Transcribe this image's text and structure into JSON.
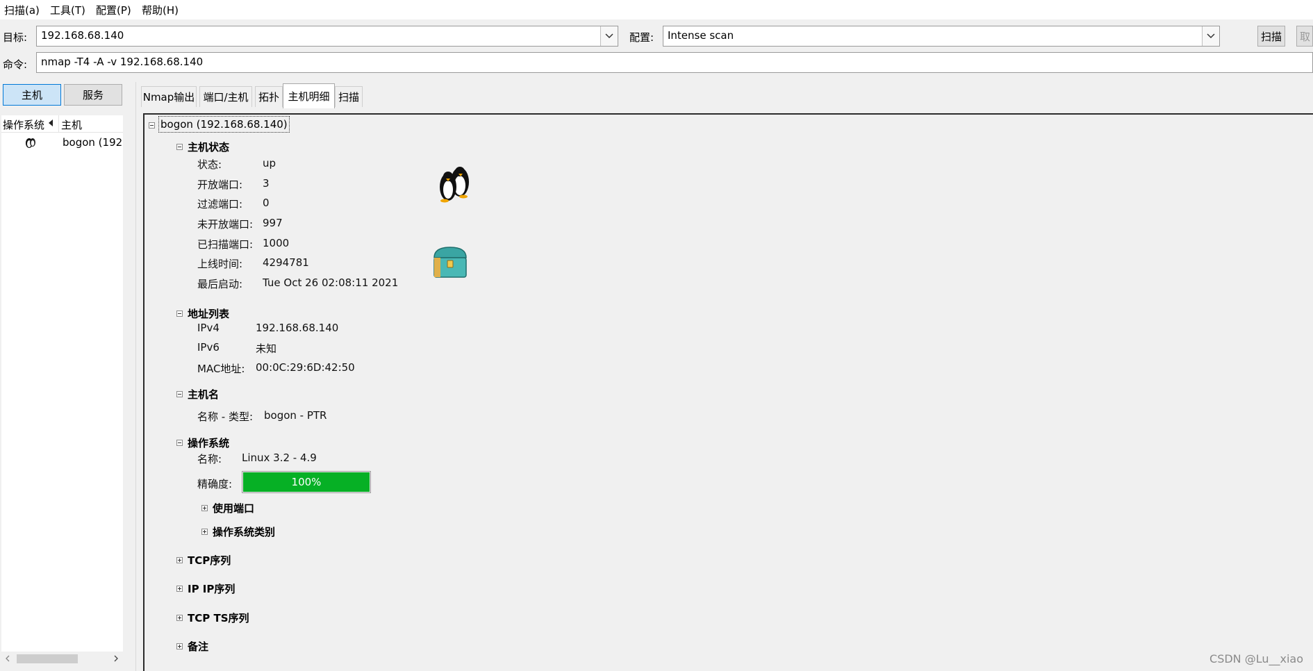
{
  "menubar": {
    "items": [
      "扫描(a)",
      "工具(T)",
      "配置(P)",
      "帮助(H)"
    ]
  },
  "toolbar": {
    "target_label": "目标:",
    "target_value": "192.168.68.140",
    "profile_label": "配置:",
    "profile_value": "Intense scan",
    "scan_button": "扫描",
    "cancel_button": "取",
    "command_label": "命令:",
    "command_value": "nmap -T4 -A -v 192.168.68.140"
  },
  "left_panel": {
    "hosts_button": "主机",
    "services_button": "服务",
    "col_os": "操作系统",
    "col_host": "主机",
    "rows": [
      {
        "host": "bogon (192"
      }
    ]
  },
  "tabs": [
    "Nmap输出",
    "端口/主机",
    "拓扑",
    "主机明细",
    "扫描"
  ],
  "active_tab": "主机明细",
  "details": {
    "root": "bogon (192.168.68.140)",
    "host_status": {
      "title": "主机状态",
      "rows": [
        {
          "k": "状态:",
          "v": "up"
        },
        {
          "k": "开放端口:",
          "v": "3"
        },
        {
          "k": "过滤端口:",
          "v": "0"
        },
        {
          "k": "未开放端口:",
          "v": "997"
        },
        {
          "k": "已扫描端口:",
          "v": "1000"
        },
        {
          "k": "上线时间:",
          "v": "4294781"
        },
        {
          "k": "最后启动:",
          "v": "Tue Oct 26 02:08:11 2021"
        }
      ]
    },
    "addresses": {
      "title": "地址列表",
      "rows": [
        {
          "k": "IPv4",
          "v": "192.168.68.140"
        },
        {
          "k": "IPv6",
          "v": "未知"
        },
        {
          "k": "MAC地址:",
          "v": "00:0C:29:6D:42:50"
        }
      ]
    },
    "hostnames": {
      "title": "主机名",
      "rows": [
        {
          "k": "名称 - 类型:",
          "v": "bogon - PTR"
        }
      ]
    },
    "os": {
      "title": "操作系统",
      "name_label": "名称:",
      "name_value": "Linux 3.2 - 4.9",
      "accuracy_label": "精确度:",
      "accuracy_text": "100%",
      "accuracy_fraction": 1.0,
      "ports_used": "使用端口",
      "os_class": "操作系统类别"
    },
    "tcp_sequence": "TCP序列",
    "ip_sequence": "IP IP序列",
    "tcp_ts_sequence": "TCP TS序列",
    "comments": "备注"
  },
  "watermark": "CSDN @Lu__xiao",
  "colors": {
    "progress": "#06b025",
    "selected_button": "#cce4f7"
  }
}
